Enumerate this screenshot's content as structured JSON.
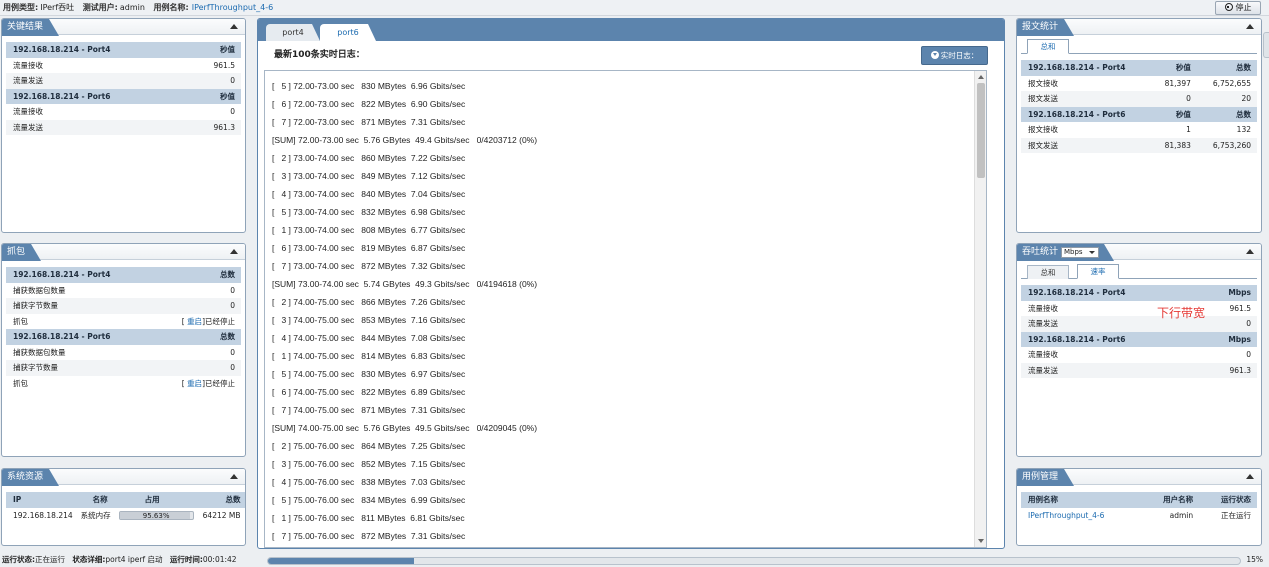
{
  "topbar": {
    "case_type_label": "用例类型:",
    "case_type_value": "IPerf吞吐",
    "user_label": "测试用户:",
    "user_value": "admin",
    "case_name_label": "用例名称:",
    "case_name_value": "IPerfThroughput_4-6",
    "stop_label": "停止"
  },
  "key_results": {
    "title": "关键结果",
    "rows": [
      {
        "c1": "192.168.18.214 - Port4",
        "c2": "秒值",
        "hdr": true
      },
      {
        "c1": "流量接收",
        "c2": "961.5"
      },
      {
        "c1": "流量发送",
        "c2": "0"
      },
      {
        "c1": "192.168.18.214 - Port6",
        "c2": "秒值",
        "hdr": true
      },
      {
        "c1": "流量接收",
        "c2": "0"
      },
      {
        "c1": "流量发送",
        "c2": "961.3"
      }
    ]
  },
  "capture": {
    "title": "抓包",
    "port4_header": "192.168.18.214 - Port4",
    "port6_header": "192.168.18.214 - Port6",
    "total_label": "总数",
    "captured_packets_label": "捕获数据包数量",
    "captured_bytes_label": "捕获字节数量",
    "capture_label": "抓包",
    "port4_packets": "0",
    "port4_bytes": "0",
    "port6_packets": "0",
    "port6_bytes": "0",
    "restart_link": "重启",
    "stopped_text": "]已经停止",
    "bracket_open": "[ "
  },
  "sys_resources": {
    "title": "系统资源",
    "headers": {
      "ip": "IP",
      "name": "名称",
      "usage": "占用",
      "total": "总数"
    },
    "row": {
      "ip": "192.168.18.214",
      "name": "系统内存",
      "usage_text": "95.63%",
      "usage_fraction": 0.96,
      "total": "64212 MB"
    }
  },
  "main": {
    "tabs": [
      "port4",
      "port6"
    ],
    "log_title": "最新100条实时日志：",
    "realtime_btn": "实时日志：",
    "log_lines": [
      "[   5 ] 72.00-73.00 sec   830 MBytes  6.96 Gbits/sec",
      "[   6 ] 72.00-73.00 sec   822 MBytes  6.90 Gbits/sec",
      "[   7 ] 72.00-73.00 sec   871 MBytes  7.31 Gbits/sec",
      "[SUM] 72.00-73.00 sec  5.76 GBytes  49.4 Gbits/sec   0/4203712 (0%)",
      "[   2 ] 73.00-74.00 sec   860 MBytes  7.22 Gbits/sec",
      "[   3 ] 73.00-74.00 sec   849 MBytes  7.12 Gbits/sec",
      "[   4 ] 73.00-74.00 sec   840 MBytes  7.04 Gbits/sec",
      "[   5 ] 73.00-74.00 sec   832 MBytes  6.98 Gbits/sec",
      "[   1 ] 73.00-74.00 sec   808 MBytes  6.77 Gbits/sec",
      "[   6 ] 73.00-74.00 sec   819 MBytes  6.87 Gbits/sec",
      "[   7 ] 73.00-74.00 sec   872 MBytes  7.32 Gbits/sec",
      "[SUM] 73.00-74.00 sec  5.74 GBytes  49.3 Gbits/sec   0/4194618 (0%)",
      "[   2 ] 74.00-75.00 sec   866 MBytes  7.26 Gbits/sec",
      "[   3 ] 74.00-75.00 sec   853 MBytes  7.16 Gbits/sec",
      "[   4 ] 74.00-75.00 sec   844 MBytes  7.08 Gbits/sec",
      "[   1 ] 74.00-75.00 sec   814 MBytes  6.83 Gbits/sec",
      "[   5 ] 74.00-75.00 sec   830 MBytes  6.97 Gbits/sec",
      "[   6 ] 74.00-75.00 sec   822 MBytes  6.89 Gbits/sec",
      "[   7 ] 74.00-75.00 sec   871 MBytes  7.31 Gbits/sec",
      "[SUM] 74.00-75.00 sec  5.76 GBytes  49.5 Gbits/sec   0/4209045 (0%)",
      "[   2 ] 75.00-76.00 sec   864 MBytes  7.25 Gbits/sec",
      "[   3 ] 75.00-76.00 sec   852 MBytes  7.15 Gbits/sec",
      "[   4 ] 75.00-76.00 sec   838 MBytes  7.03 Gbits/sec",
      "[   5 ] 75.00-76.00 sec   834 MBytes  6.99 Gbits/sec",
      "[   1 ] 75.00-76.00 sec   811 MBytes  6.81 Gbits/sec",
      "[   7 ] 75.00-76.00 sec   872 MBytes  7.31 Gbits/sec"
    ]
  },
  "packet_stats": {
    "title": "报文统计",
    "tab": "总和",
    "rows": [
      {
        "c1": "192.168.18.214 - Port4",
        "c2": "秒值",
        "c3": "总数",
        "hdr": true
      },
      {
        "c1": "报文接收",
        "c2": "81,397",
        "c3": "6,752,655"
      },
      {
        "c1": "报文发送",
        "c2": "0",
        "c3": "20"
      },
      {
        "c1": "192.168.18.214 - Port6",
        "c2": "秒值",
        "c3": "总数",
        "hdr": true
      },
      {
        "c1": "报文接收",
        "c2": "1",
        "c3": "132"
      },
      {
        "c1": "报文发送",
        "c2": "81,383",
        "c3": "6,753,260"
      }
    ]
  },
  "throughput": {
    "title": "吞吐统计",
    "unit_select": "Mbps",
    "tabs": [
      "总和",
      "速率"
    ],
    "annotation": "下行带宽",
    "rows": [
      {
        "c1": "192.168.18.214 - Port4",
        "c2": "Mbps",
        "hdr": true
      },
      {
        "c1": "流量接收",
        "c2": "961.5"
      },
      {
        "c1": "流量发送",
        "c2": "0"
      },
      {
        "c1": "192.168.18.214 - Port6",
        "c2": "Mbps",
        "hdr": true
      },
      {
        "c1": "流量接收",
        "c2": "0"
      },
      {
        "c1": "流量发送",
        "c2": "961.3"
      }
    ]
  },
  "case_mgmt": {
    "title": "用例管理",
    "headers": {
      "name": "用例名称",
      "user": "用户名称",
      "status": "运行状态"
    },
    "row": {
      "name": "IPerfThroughput_4-6",
      "user": "admin",
      "status": "正在运行"
    }
  },
  "statusbar": {
    "run_state_label": "运行状态:",
    "run_state_value": "正在运行",
    "detail_label": "状态详细:",
    "detail_value": "port4 iperf 启动",
    "time_label": "运行时间:",
    "time_value": "00:01:42",
    "progress_fraction": 0.15,
    "progress_text": "15%"
  }
}
